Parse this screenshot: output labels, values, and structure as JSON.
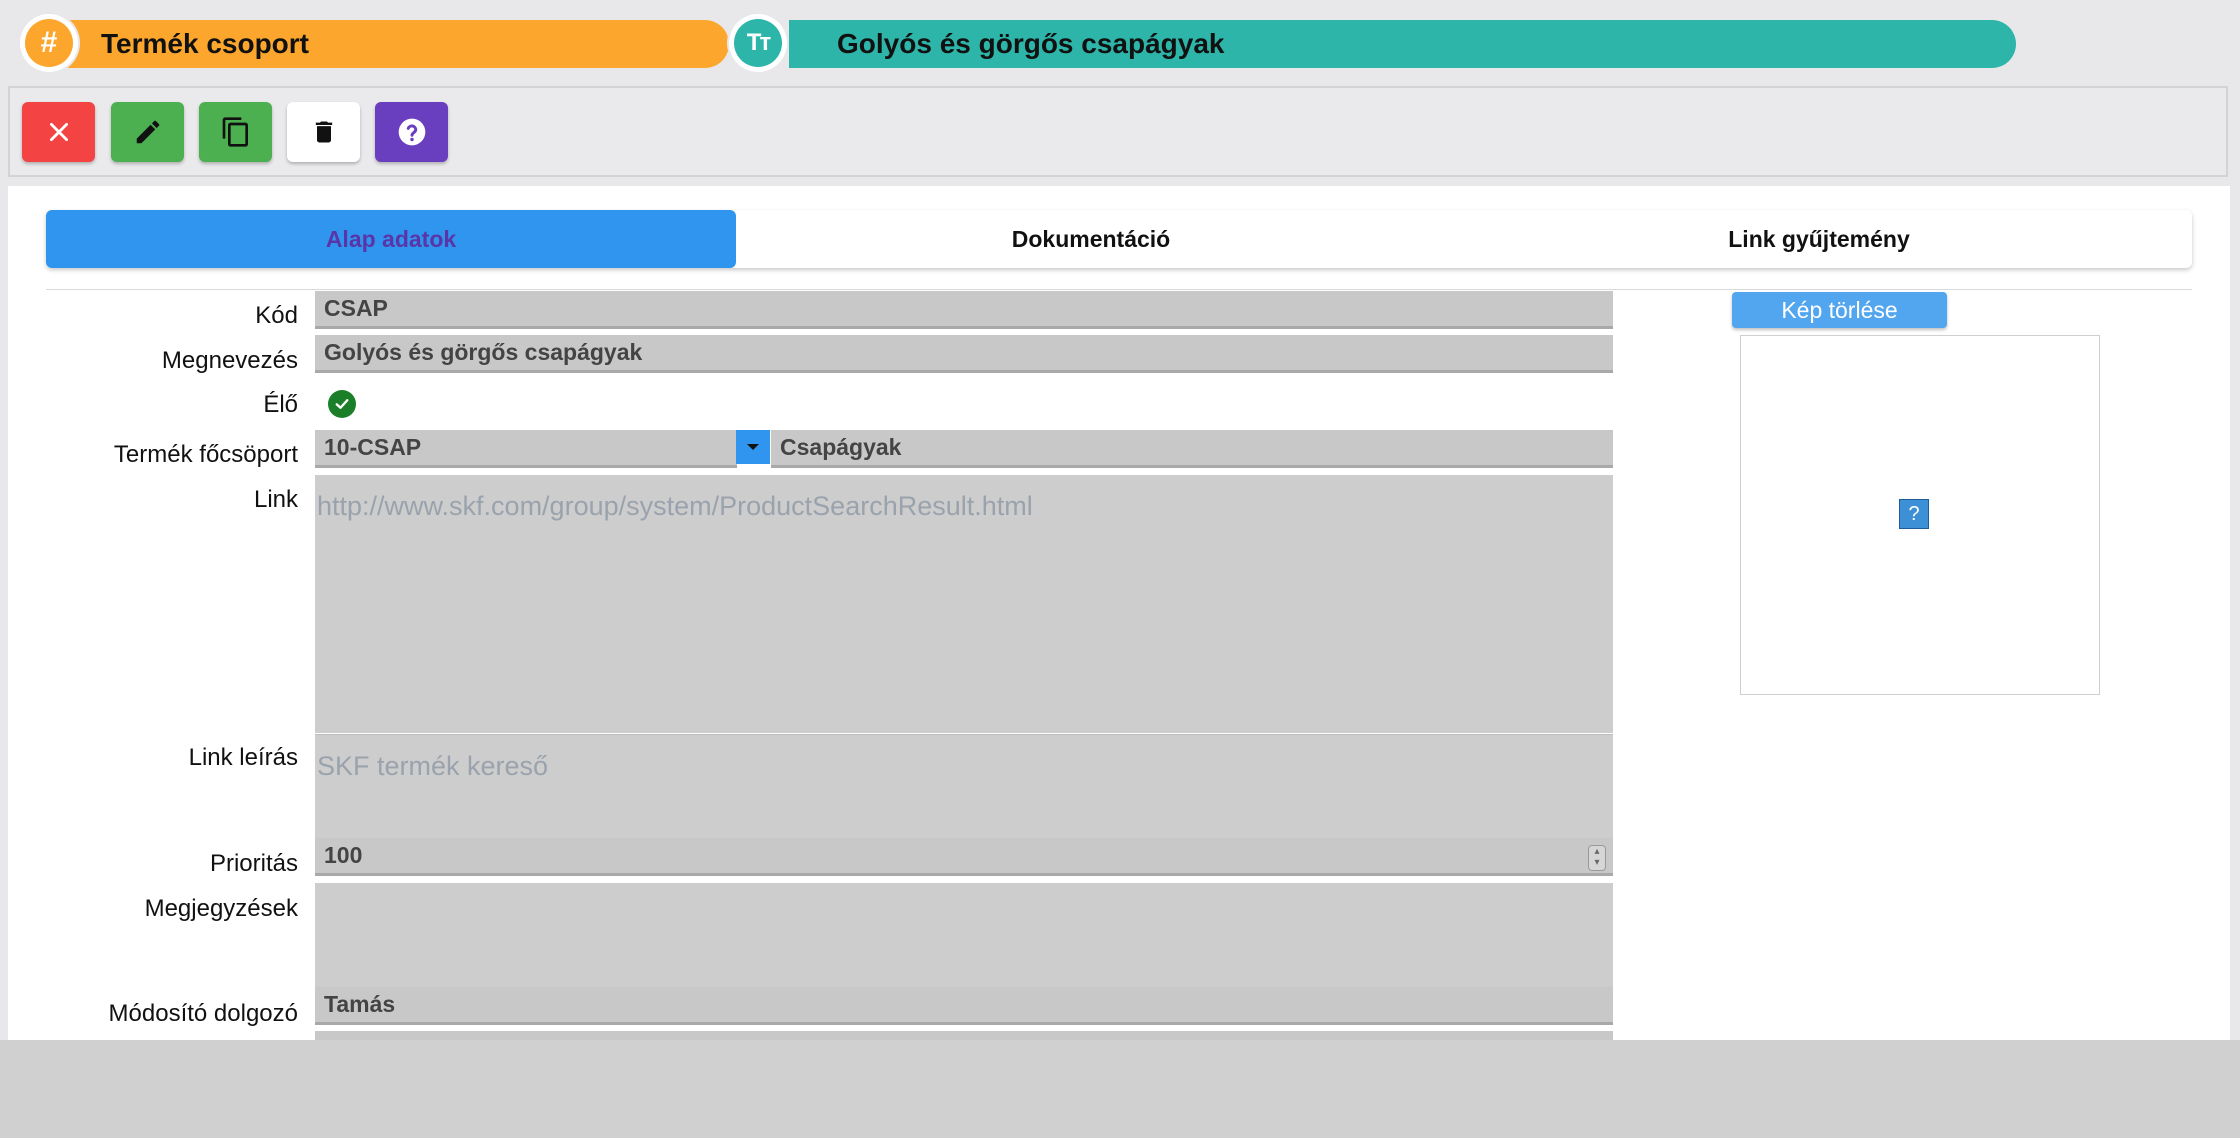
{
  "header": {
    "group_label": "Termék csoport",
    "group_icon": "#",
    "name_value": "Golyós és görgős csapágyak",
    "name_icon": "Tт"
  },
  "toolbar": {
    "close_icon": "close-icon",
    "edit_icon": "pencil-icon",
    "copy_icon": "copy-icon",
    "delete_icon": "trash-icon",
    "help_icon": "help-icon"
  },
  "tabs": [
    {
      "label": "Alap adatok",
      "active": true
    },
    {
      "label": "Dokumentáció",
      "active": false
    },
    {
      "label": "Link gyűjtemény",
      "active": false
    }
  ],
  "form": {
    "kod": {
      "label": "Kód",
      "value": "CSAP"
    },
    "megnevezes": {
      "label": "Megnevezés",
      "value": "Golyós és görgős csapágyak"
    },
    "elo": {
      "label": "Élő",
      "checked": true
    },
    "focsoport": {
      "label": "Termék főcsöport",
      "code": "10-CSAP",
      "name": "Csapágyak"
    },
    "link": {
      "label": "Link",
      "value": "http://www.skf.com/group/system/ProductSearchResult.html"
    },
    "link_leiras": {
      "label": "Link leírás",
      "value": "SKF termék kereső"
    },
    "prioritas": {
      "label": "Prioritás",
      "value": "100"
    },
    "megjegyzesek": {
      "label": "Megjegyzések",
      "value": ""
    },
    "modosito": {
      "label": "Módosító dolgozó",
      "value": "Tamás"
    }
  },
  "image": {
    "delete_label": "Kép törlése",
    "placeholder": "?"
  },
  "colors": {
    "orange": "#fca62e",
    "teal": "#2db5a9",
    "active_tab": "#2f95ef",
    "red": "#f34343",
    "green": "#4caf50",
    "purple": "#6a3fbf"
  }
}
